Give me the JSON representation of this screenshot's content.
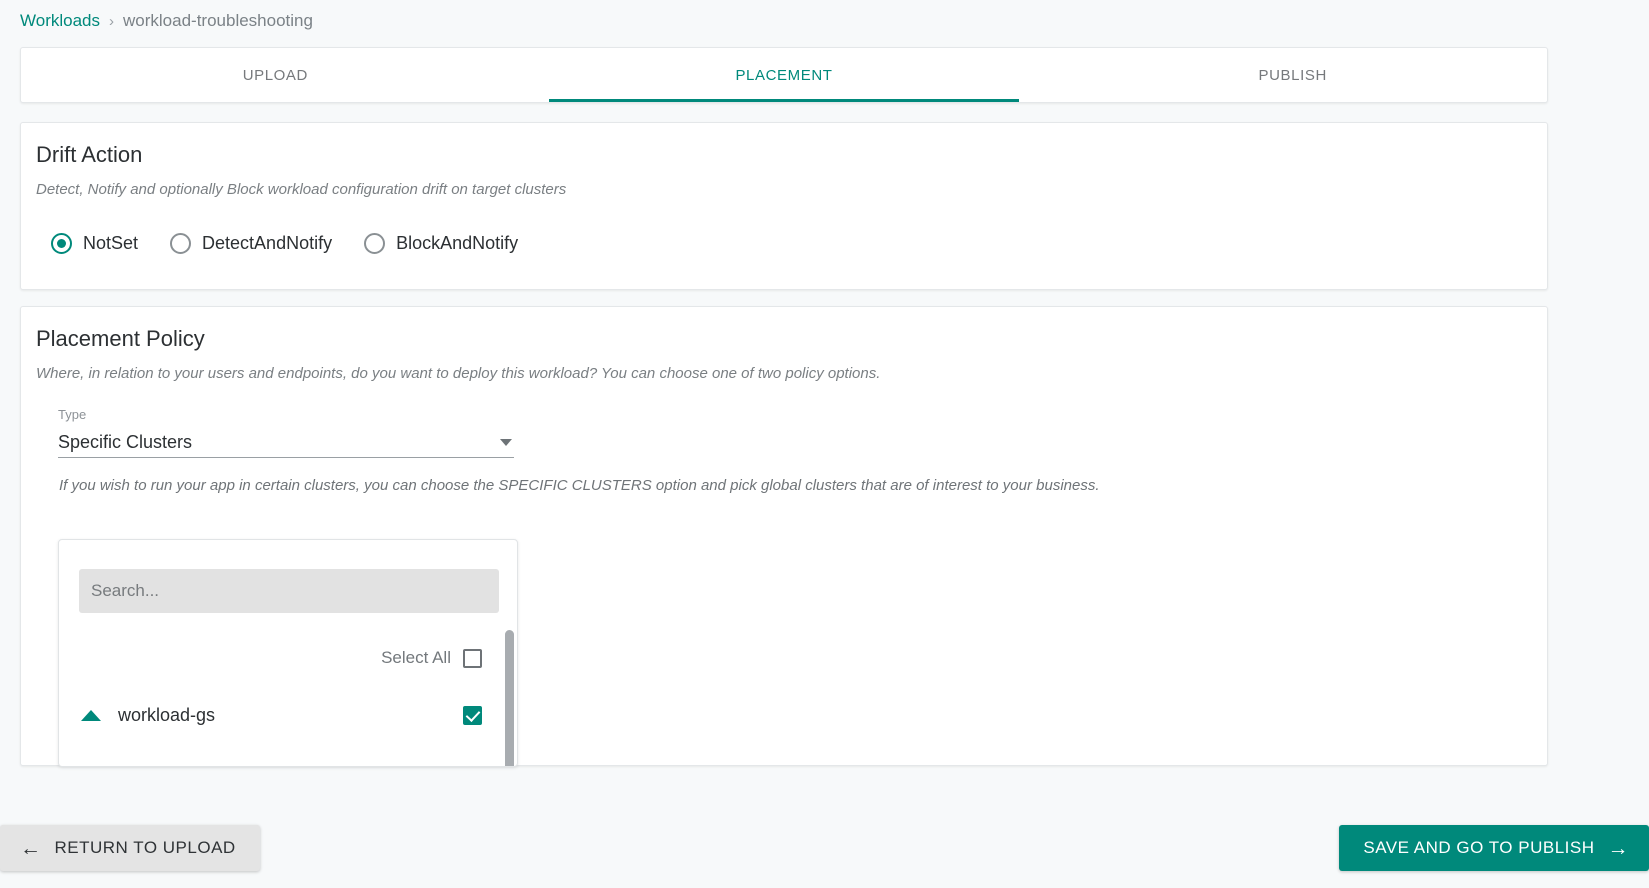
{
  "breadcrumb": {
    "root": "Workloads",
    "separator": "›",
    "current": "workload-troubleshooting"
  },
  "tabs": [
    {
      "label": "UPLOAD",
      "active": false
    },
    {
      "label": "PLACEMENT",
      "active": true
    },
    {
      "label": "PUBLISH",
      "active": false
    }
  ],
  "drift_action": {
    "title": "Drift Action",
    "description": "Detect, Notify and optionally Block workload configuration drift on target clusters",
    "options": [
      {
        "label": "NotSet",
        "selected": true
      },
      {
        "label": "DetectAndNotify",
        "selected": false
      },
      {
        "label": "BlockAndNotify",
        "selected": false
      }
    ]
  },
  "placement_policy": {
    "title": "Placement Policy",
    "description": "Where, in relation to your users and endpoints, do you want to deploy this workload? You can choose one of two policy options.",
    "type_field": {
      "label": "Type",
      "value": "Specific Clusters",
      "icon": "chevron-down-icon"
    },
    "hint": "If you wish to run your app in certain clusters, you can choose the SPECIFIC CLUSTERS option and pick global clusters that are of interest to your business.",
    "cluster_selector": {
      "search_placeholder": "Search...",
      "search_value": "",
      "select_all_label": "Select All",
      "select_all_checked": false,
      "clusters": [
        {
          "name": "workload-gs",
          "checked": true,
          "expander_icon": "triangle-up-icon"
        }
      ]
    }
  },
  "footer": {
    "back_label": "RETURN TO UPLOAD",
    "back_icon": "arrow-left-icon",
    "next_label": "SAVE AND GO TO PUBLISH",
    "next_icon": "arrow-right-icon"
  },
  "colors": {
    "accent": "#00897b",
    "page_bg": "#f7f9fa",
    "card_bg": "#ffffff",
    "muted_text": "#7a7f83"
  }
}
